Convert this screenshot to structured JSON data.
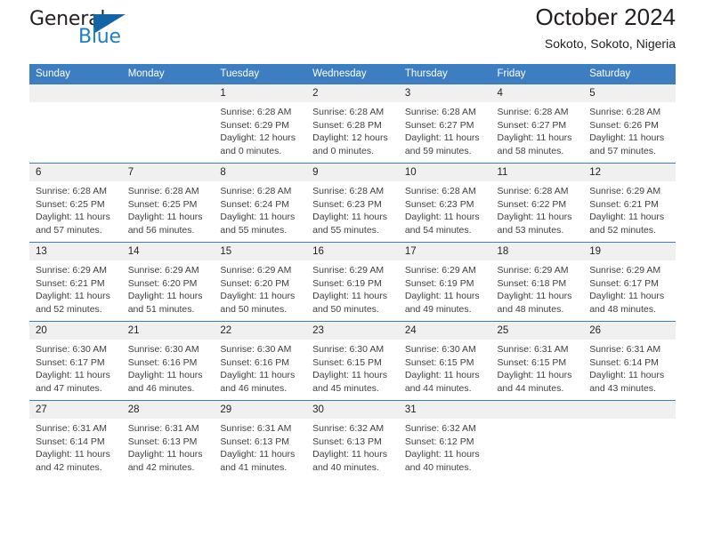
{
  "logo": {
    "word1": "General",
    "word2": "Blue",
    "icon": "triangle-flag-icon",
    "color_dark": "#231f20",
    "color_blue": "#1f7fc4",
    "color_triangle": "#1464a5"
  },
  "header": {
    "title": "October 2024",
    "subtitle": "Sokoto, Sokoto, Nigeria"
  },
  "theme": {
    "header_bg": "#3c7ec1",
    "daynum_bg": "#f0f0f0",
    "grid_line": "#3c7ec1"
  },
  "weekdays": [
    "Sunday",
    "Monday",
    "Tuesday",
    "Wednesday",
    "Thursday",
    "Friday",
    "Saturday"
  ],
  "weeks": [
    [
      {
        "day": "",
        "lines": []
      },
      {
        "day": "",
        "lines": []
      },
      {
        "day": "1",
        "lines": [
          "Sunrise: 6:28 AM",
          "Sunset: 6:29 PM",
          "Daylight: 12 hours",
          "and 0 minutes."
        ]
      },
      {
        "day": "2",
        "lines": [
          "Sunrise: 6:28 AM",
          "Sunset: 6:28 PM",
          "Daylight: 12 hours",
          "and 0 minutes."
        ]
      },
      {
        "day": "3",
        "lines": [
          "Sunrise: 6:28 AM",
          "Sunset: 6:27 PM",
          "Daylight: 11 hours",
          "and 59 minutes."
        ]
      },
      {
        "day": "4",
        "lines": [
          "Sunrise: 6:28 AM",
          "Sunset: 6:27 PM",
          "Daylight: 11 hours",
          "and 58 minutes."
        ]
      },
      {
        "day": "5",
        "lines": [
          "Sunrise: 6:28 AM",
          "Sunset: 6:26 PM",
          "Daylight: 11 hours",
          "and 57 minutes."
        ]
      }
    ],
    [
      {
        "day": "6",
        "lines": [
          "Sunrise: 6:28 AM",
          "Sunset: 6:25 PM",
          "Daylight: 11 hours",
          "and 57 minutes."
        ]
      },
      {
        "day": "7",
        "lines": [
          "Sunrise: 6:28 AM",
          "Sunset: 6:25 PM",
          "Daylight: 11 hours",
          "and 56 minutes."
        ]
      },
      {
        "day": "8",
        "lines": [
          "Sunrise: 6:28 AM",
          "Sunset: 6:24 PM",
          "Daylight: 11 hours",
          "and 55 minutes."
        ]
      },
      {
        "day": "9",
        "lines": [
          "Sunrise: 6:28 AM",
          "Sunset: 6:23 PM",
          "Daylight: 11 hours",
          "and 55 minutes."
        ]
      },
      {
        "day": "10",
        "lines": [
          "Sunrise: 6:28 AM",
          "Sunset: 6:23 PM",
          "Daylight: 11 hours",
          "and 54 minutes."
        ]
      },
      {
        "day": "11",
        "lines": [
          "Sunrise: 6:28 AM",
          "Sunset: 6:22 PM",
          "Daylight: 11 hours",
          "and 53 minutes."
        ]
      },
      {
        "day": "12",
        "lines": [
          "Sunrise: 6:29 AM",
          "Sunset: 6:21 PM",
          "Daylight: 11 hours",
          "and 52 minutes."
        ]
      }
    ],
    [
      {
        "day": "13",
        "lines": [
          "Sunrise: 6:29 AM",
          "Sunset: 6:21 PM",
          "Daylight: 11 hours",
          "and 52 minutes."
        ]
      },
      {
        "day": "14",
        "lines": [
          "Sunrise: 6:29 AM",
          "Sunset: 6:20 PM",
          "Daylight: 11 hours",
          "and 51 minutes."
        ]
      },
      {
        "day": "15",
        "lines": [
          "Sunrise: 6:29 AM",
          "Sunset: 6:20 PM",
          "Daylight: 11 hours",
          "and 50 minutes."
        ]
      },
      {
        "day": "16",
        "lines": [
          "Sunrise: 6:29 AM",
          "Sunset: 6:19 PM",
          "Daylight: 11 hours",
          "and 50 minutes."
        ]
      },
      {
        "day": "17",
        "lines": [
          "Sunrise: 6:29 AM",
          "Sunset: 6:19 PM",
          "Daylight: 11 hours",
          "and 49 minutes."
        ]
      },
      {
        "day": "18",
        "lines": [
          "Sunrise: 6:29 AM",
          "Sunset: 6:18 PM",
          "Daylight: 11 hours",
          "and 48 minutes."
        ]
      },
      {
        "day": "19",
        "lines": [
          "Sunrise: 6:29 AM",
          "Sunset: 6:17 PM",
          "Daylight: 11 hours",
          "and 48 minutes."
        ]
      }
    ],
    [
      {
        "day": "20",
        "lines": [
          "Sunrise: 6:30 AM",
          "Sunset: 6:17 PM",
          "Daylight: 11 hours",
          "and 47 minutes."
        ]
      },
      {
        "day": "21",
        "lines": [
          "Sunrise: 6:30 AM",
          "Sunset: 6:16 PM",
          "Daylight: 11 hours",
          "and 46 minutes."
        ]
      },
      {
        "day": "22",
        "lines": [
          "Sunrise: 6:30 AM",
          "Sunset: 6:16 PM",
          "Daylight: 11 hours",
          "and 46 minutes."
        ]
      },
      {
        "day": "23",
        "lines": [
          "Sunrise: 6:30 AM",
          "Sunset: 6:15 PM",
          "Daylight: 11 hours",
          "and 45 minutes."
        ]
      },
      {
        "day": "24",
        "lines": [
          "Sunrise: 6:30 AM",
          "Sunset: 6:15 PM",
          "Daylight: 11 hours",
          "and 44 minutes."
        ]
      },
      {
        "day": "25",
        "lines": [
          "Sunrise: 6:31 AM",
          "Sunset: 6:15 PM",
          "Daylight: 11 hours",
          "and 44 minutes."
        ]
      },
      {
        "day": "26",
        "lines": [
          "Sunrise: 6:31 AM",
          "Sunset: 6:14 PM",
          "Daylight: 11 hours",
          "and 43 minutes."
        ]
      }
    ],
    [
      {
        "day": "27",
        "lines": [
          "Sunrise: 6:31 AM",
          "Sunset: 6:14 PM",
          "Daylight: 11 hours",
          "and 42 minutes."
        ]
      },
      {
        "day": "28",
        "lines": [
          "Sunrise: 6:31 AM",
          "Sunset: 6:13 PM",
          "Daylight: 11 hours",
          "and 42 minutes."
        ]
      },
      {
        "day": "29",
        "lines": [
          "Sunrise: 6:31 AM",
          "Sunset: 6:13 PM",
          "Daylight: 11 hours",
          "and 41 minutes."
        ]
      },
      {
        "day": "30",
        "lines": [
          "Sunrise: 6:32 AM",
          "Sunset: 6:13 PM",
          "Daylight: 11 hours",
          "and 40 minutes."
        ]
      },
      {
        "day": "31",
        "lines": [
          "Sunrise: 6:32 AM",
          "Sunset: 6:12 PM",
          "Daylight: 11 hours",
          "and 40 minutes."
        ]
      },
      {
        "day": "",
        "lines": []
      },
      {
        "day": "",
        "lines": []
      }
    ]
  ]
}
